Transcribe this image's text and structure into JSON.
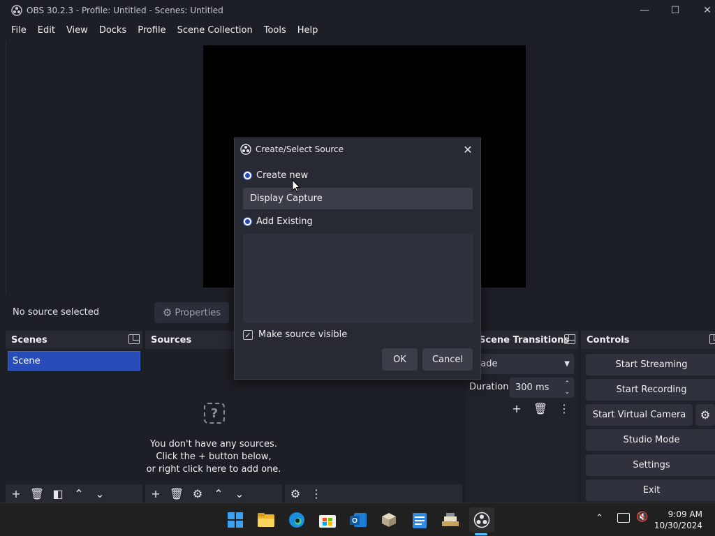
{
  "window": {
    "title": "OBS 30.2.3 - Profile: Untitled - Scenes: Untitled",
    "minimize_label": "—",
    "maximize_label": "☐",
    "close_label": "✕"
  },
  "menu": [
    "File",
    "Edit",
    "View",
    "Docks",
    "Profile",
    "Scene Collection",
    "Tools",
    "Help"
  ],
  "source_toolbar": {
    "status": "No source selected",
    "properties_label": "Properties"
  },
  "scenes": {
    "title": "Scenes",
    "items": [
      "Scene"
    ]
  },
  "sources": {
    "title": "Sources",
    "empty_line1": "You don't have any sources.",
    "empty_line2": "Click the + button below,",
    "empty_line3": "or right click here to add one."
  },
  "transitions": {
    "title": "Scene Transitions",
    "selected": "Fade",
    "duration_label": "Duration",
    "duration_value": "300 ms"
  },
  "controls": {
    "title": "Controls",
    "buttons": [
      "Start Streaming",
      "Start Recording",
      "Start Virtual Camera",
      "Studio Mode",
      "Settings",
      "Exit"
    ]
  },
  "dialog": {
    "title": "Create/Select Source",
    "create_new_label": "Create new",
    "name_value": "Display Capture",
    "add_existing_label": "Add Existing",
    "make_visible_label": "Make source visible",
    "make_visible_checked": true,
    "ok_label": "OK",
    "cancel_label": "Cancel"
  },
  "taskbar": {
    "time": "9:09 AM",
    "date": "10/30/2024",
    "apps": [
      "windows-start-icon",
      "file-explorer-icon",
      "edge-browser-icon",
      "microsoft-store-icon",
      "outlook-icon",
      "3d-box-icon",
      "notepad-icon",
      "stack-app-icon",
      "obs-studio-icon"
    ]
  },
  "colors": {
    "accent": "#284cb8",
    "background": "#1d1f26",
    "panel": "#272a33",
    "button": "#2f323c"
  }
}
